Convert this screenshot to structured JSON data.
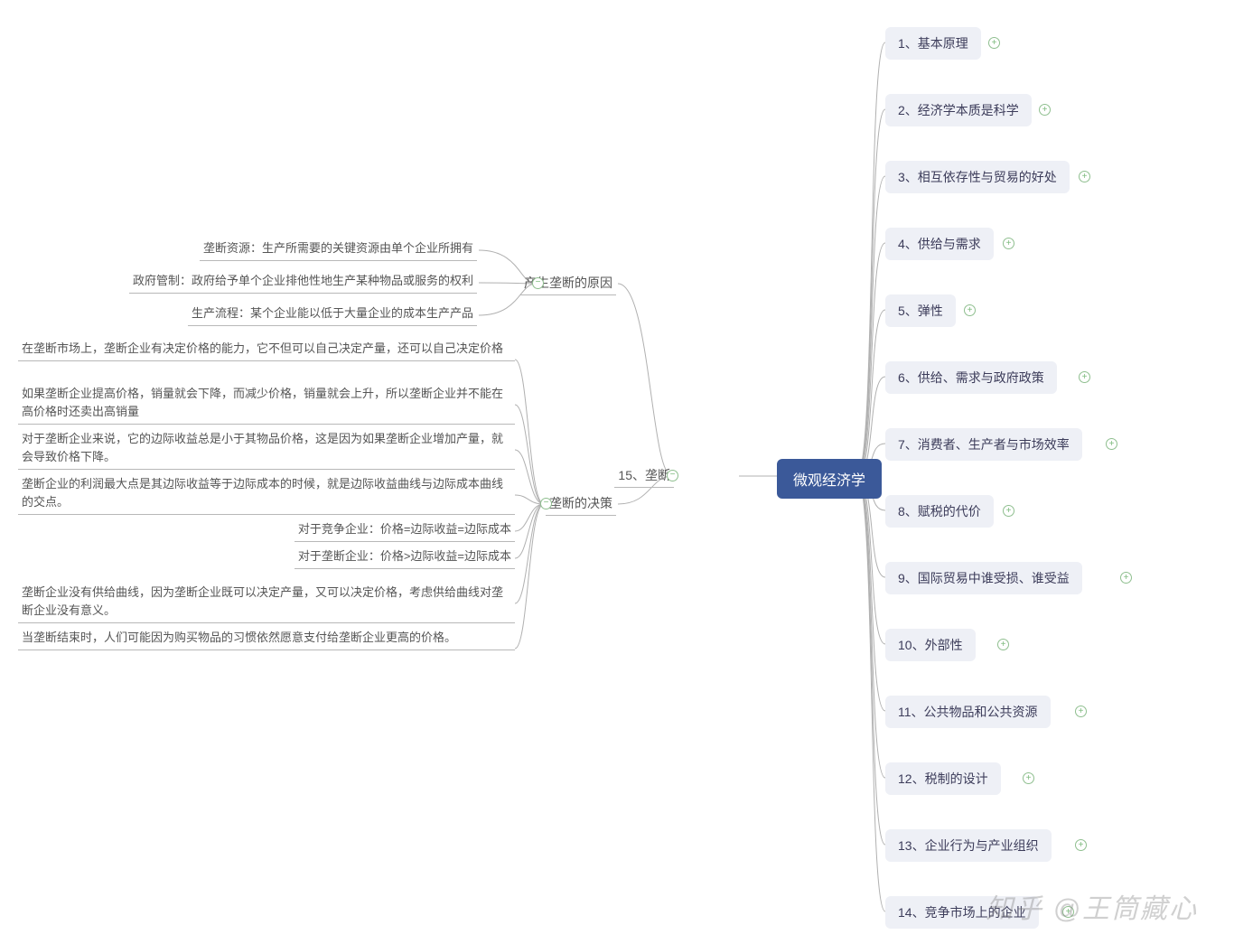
{
  "root": {
    "label": "微观经济学"
  },
  "left": {
    "branch15": "15、垄断",
    "cause": {
      "label": "产生垄断的原因",
      "items": [
        "垄断资源：生产所需要的关键资源由单个企业所拥有",
        "政府管制：政府给予单个企业排他性地生产某种物品或服务的权利",
        "生产流程：某个企业能以低于大量企业的成本生产产品"
      ]
    },
    "decision": {
      "label": "垄断的决策",
      "items": [
        "在垄断市场上，垄断企业有决定价格的能力，它不但可以自己决定产量，还可以自己决定价格",
        "如果垄断企业提高价格，销量就会下降，而减少价格，销量就会上升，所以垄断企业并不能在高价格时还卖出高销量",
        "对于垄断企业来说，它的边际收益总是小于其物品价格，这是因为如果垄断企业增加产量，就会导致价格下降。",
        "垄断企业的利润最大点是其边际收益等于边际成本的时候，就是边际收益曲线与边际成本曲线的交点。",
        "对于竞争企业：价格=边际收益=边际成本",
        "对于垄断企业：价格>边际收益=边际成本",
        "垄断企业没有供给曲线，因为垄断企业既可以决定产量，又可以决定价格，考虑供给曲线对垄断企业没有意义。",
        "当垄断结束时，人们可能因为购买物品的习惯依然愿意支付给垄断企业更高的价格。"
      ]
    }
  },
  "right": {
    "items": [
      "1、基本原理",
      "2、经济学本质是科学",
      "3、相互依存性与贸易的好处",
      "4、供给与需求",
      "5、弹性",
      "6、供给、需求与政府政策",
      "7、消费者、生产者与市场效率",
      "8、赋税的代价",
      "9、国际贸易中谁受损、谁受益",
      "10、外部性",
      "11、公共物品和公共资源",
      "12、税制的设计",
      "13、企业行为与产业组织",
      "14、竞争市场上的企业"
    ]
  },
  "watermark": "知乎 @王筒藏心",
  "colors": {
    "root_bg": "#3b5999",
    "branch_bg": "#eef0f6",
    "connector": "#b0b0b0"
  }
}
